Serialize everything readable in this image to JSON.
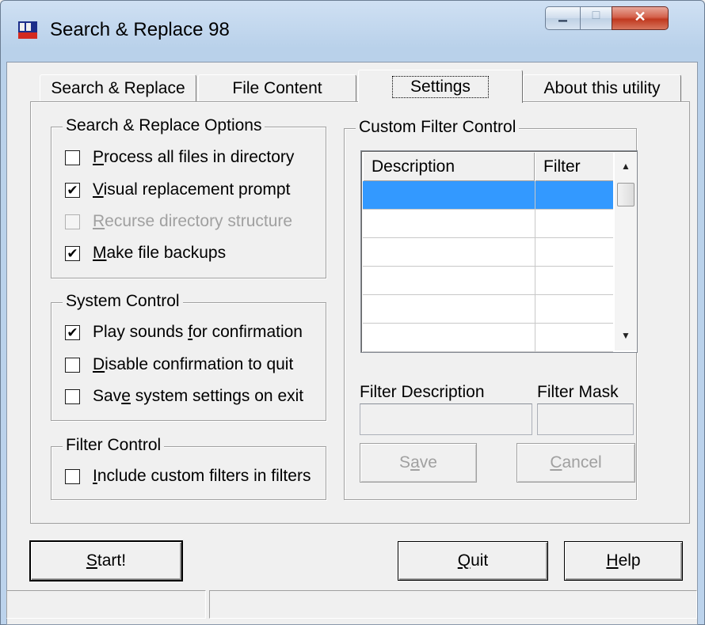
{
  "window": {
    "title": "Search & Replace 98",
    "minimize_glyph": "▁",
    "maximize_glyph": "□",
    "close_glyph": "✕"
  },
  "tabs": [
    {
      "label": "Search & Replace"
    },
    {
      "label": "File Content"
    },
    {
      "label": "Settings",
      "selected": true
    },
    {
      "label": "About this utility"
    }
  ],
  "search_replace_options": {
    "title": "Search & Replace Options",
    "items": [
      {
        "pre": "",
        "accel": "P",
        "post": "rocess all files in directory",
        "checked": false,
        "enabled": true
      },
      {
        "pre": "",
        "accel": "V",
        "post": "isual replacement prompt",
        "checked": true,
        "enabled": true
      },
      {
        "pre": "",
        "accel": "R",
        "post": "ecurse directory structure",
        "checked": false,
        "enabled": false
      },
      {
        "pre": "",
        "accel": "M",
        "post": "ake file backups",
        "checked": true,
        "enabled": true
      }
    ]
  },
  "system_control": {
    "title": "System Control",
    "items": [
      {
        "pre": "Play sounds ",
        "accel": "f",
        "post": "or confirmation",
        "checked": true,
        "enabled": true
      },
      {
        "pre": "",
        "accel": "D",
        "post": "isable confirmation to quit",
        "checked": false,
        "enabled": true
      },
      {
        "pre": "Sav",
        "accel": "e",
        "post": " system settings on exit",
        "checked": false,
        "enabled": true
      }
    ]
  },
  "filter_control": {
    "title": "Filter Control",
    "items": [
      {
        "pre": "",
        "accel": "I",
        "post": "nclude custom filters in filters",
        "checked": false,
        "enabled": true
      }
    ]
  },
  "custom_filter": {
    "title": "Custom Filter Control",
    "columns": [
      "Description",
      "Filter"
    ],
    "rows": [
      {
        "description": "",
        "filter": "",
        "selected": true
      },
      {
        "description": "",
        "filter": ""
      },
      {
        "description": "",
        "filter": ""
      },
      {
        "description": "",
        "filter": ""
      },
      {
        "description": "",
        "filter": ""
      },
      {
        "description": "",
        "filter": ""
      }
    ],
    "scroll_up_glyph": "▲",
    "scroll_down_glyph": "▼",
    "filter_description_label": "Filter Description",
    "filter_mask_label": "Filter Mask",
    "filter_description_value": "",
    "filter_mask_value": "",
    "save": {
      "pre": "S",
      "accel": "a",
      "post": "ve"
    },
    "cancel": {
      "pre": "",
      "accel": "C",
      "post": "ancel"
    }
  },
  "footer": {
    "start": {
      "pre": "",
      "accel": "S",
      "post": "tart!"
    },
    "quit": {
      "pre": "",
      "accel": "Q",
      "post": "uit"
    },
    "help": {
      "pre": "",
      "accel": "H",
      "post": "elp"
    }
  },
  "status_bar": {
    "left": "",
    "right": ""
  },
  "colors": {
    "selection": "#3399ff",
    "close_button": "#c0391f",
    "titlebar": "#b9d1ea"
  }
}
